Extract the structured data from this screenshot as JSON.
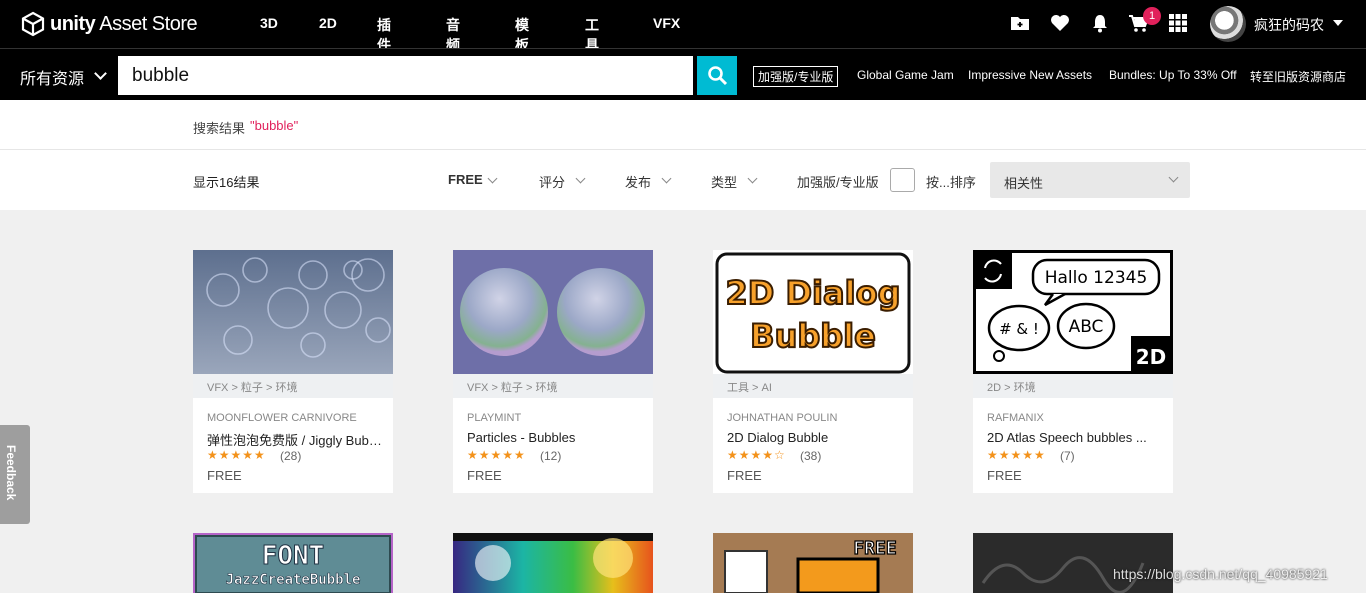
{
  "header": {
    "logo_bold": "unity",
    "logo_rest": " Asset Store",
    "nav": [
      "3D",
      "2D",
      "插件",
      "音频",
      "模板",
      "工具",
      "VFX"
    ],
    "cart_count": "1",
    "username": "疯狂的码农"
  },
  "search": {
    "scope_label": "所有资源",
    "query": "bubble",
    "plus_pro_label": "加强版/专业版",
    "promos": [
      "Global Game Jam",
      "Impressive New Assets",
      "Bundles: Up To 33% Off",
      "转至旧版资源商店"
    ]
  },
  "breadcrumb": {
    "label": "搜索结果",
    "term": "\"bubble\""
  },
  "filters": {
    "result_count": "显示16结果",
    "price": "FREE",
    "rating": "评分",
    "release": "发布",
    "type": "类型",
    "plus_pro": "加强版/专业版",
    "sort_by": "按...排序",
    "sort_value": "相关性"
  },
  "cards": [
    {
      "category": "VFX > 粒子 > 环境",
      "publisher": "MOONFLOWER CARNIVORE",
      "title": "弹性泡泡免费版 / Jiggly Bubble Free",
      "stars": "★★★★★",
      "rating_count": "(28)",
      "price": "FREE"
    },
    {
      "category": "VFX > 粒子 > 环境",
      "publisher": "PLAYMINT",
      "title": "Particles - Bubbles",
      "stars": "★★★★★",
      "rating_count": "(12)",
      "price": "FREE"
    },
    {
      "category": "工具 > AI",
      "publisher": "JOHNATHAN POULIN",
      "title": "2D Dialog Bubble",
      "stars": "★★★★☆",
      "rating_count": "(38)",
      "price": "FREE"
    },
    {
      "category": "2D > 环境",
      "publisher": "RAFMANIX",
      "title": "2D Atlas Speech bubbles ...",
      "stars": "★★★★★",
      "rating_count": "(7)",
      "price": "FREE"
    }
  ],
  "thumb_text": {
    "dialog_line1": "2D Dialog",
    "dialog_line2": "Bubble",
    "speech_hallo": "Hallo 12345",
    "speech_sym": "# & !",
    "speech_abc": "ABC",
    "speech_2d": "2D",
    "font_title": "FONT",
    "font_sub": "JazzCreateBubble",
    "free_tag": "FREE"
  },
  "feedback_label": "Feedback",
  "watermark": "https://blog.csdn.net/qq_40985921",
  "colors": {
    "accent": "#00bbd3",
    "badge": "#e1215b",
    "star": "#f3921a"
  }
}
